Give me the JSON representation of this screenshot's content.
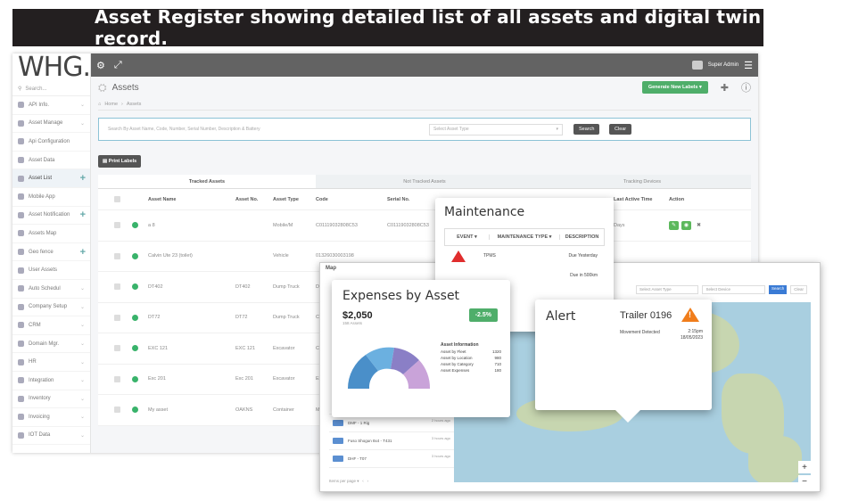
{
  "banner": {
    "text": "Asset Register showing detailed list of all  assets and digital twin record."
  },
  "sidebar": {
    "logo": "WHG.",
    "search": "Search...",
    "items": [
      {
        "label": "API Info.",
        "suffix": "chev"
      },
      {
        "label": "Asset Manage",
        "suffix": "chev"
      },
      {
        "label": "Api Configuration",
        "suffix": ""
      },
      {
        "label": "Asset Data",
        "suffix": ""
      },
      {
        "label": "Asset List",
        "suffix": "plus",
        "active": true
      },
      {
        "label": "Mobile App",
        "suffix": ""
      },
      {
        "label": "Asset Notification",
        "suffix": "plus"
      },
      {
        "label": "Assets Map",
        "suffix": ""
      },
      {
        "label": "Geo fence",
        "suffix": "plus"
      },
      {
        "label": "User Assets",
        "suffix": ""
      },
      {
        "label": "Auto Schedul",
        "suffix": "chev"
      },
      {
        "label": "Company Setup",
        "suffix": "chev"
      },
      {
        "label": "CRM",
        "suffix": "chev"
      },
      {
        "label": "Domain Mgr.",
        "suffix": "chev"
      },
      {
        "label": "HR",
        "suffix": "chev"
      },
      {
        "label": "Integration",
        "suffix": "chev"
      },
      {
        "label": "Inventory",
        "suffix": "chev"
      },
      {
        "label": "Invoicing",
        "suffix": "chev"
      },
      {
        "label": "IOT Data",
        "suffix": "chev"
      }
    ]
  },
  "topbar": {
    "user": "Super Admin"
  },
  "page": {
    "title": "Assets",
    "generate_label": "Generate New Labels",
    "breadcrumb_home": "Home",
    "breadcrumb_current": "Assets",
    "search_placeholder": "Search By Asset Name, Code, Number, Serial Number, Description & Battery",
    "asset_type_placeholder": "Select Asset Type",
    "search_btn": "Search",
    "clear_btn": "Clear",
    "print_labels": "Print Labels",
    "tabs": [
      "Tracked Assets",
      "Not Tracked Assets",
      "Tracking Devices"
    ]
  },
  "table": {
    "headers": {
      "name": "Asset Name",
      "no": "Asset No.",
      "type": "Asset Type",
      "code": "Code",
      "serial": "Serial No.",
      "active": "Last Active Time",
      "action": "Action"
    },
    "rows": [
      {
        "name": "a 8",
        "no": "",
        "type": "Mobile/M",
        "code": "C01119032808C53",
        "serial": "C01119032808C53",
        "active": "Days"
      },
      {
        "name": "Calvin Ute 23 (toilet)",
        "no": "",
        "type": "Vehicle",
        "code": "01326030003198",
        "serial": "",
        "active": ""
      },
      {
        "name": "DT402",
        "no": "DT402",
        "type": "Dump Truck",
        "code": "DT402",
        "serial": "",
        "active": ""
      },
      {
        "name": "DT72",
        "no": "DT72",
        "type": "Dump Truck",
        "code": "C011",
        "serial": "",
        "active": ""
      },
      {
        "name": "EXC 121",
        "no": "EXC 121",
        "type": "Excavator",
        "code": "C011",
        "serial": "",
        "active": ""
      },
      {
        "name": "Exc 201",
        "no": "Exc 201",
        "type": "Excavator",
        "code": "Exc 201",
        "serial": "",
        "active": ""
      },
      {
        "name": "My asset",
        "no": "OAKNS",
        "type": "Container",
        "code": "Myas",
        "serial": "",
        "active": ""
      }
    ]
  },
  "maintenance": {
    "title": "Maintenance",
    "col_event": "EVENT",
    "col_type": "MAINTENANCE TYPE",
    "col_desc": "DESCRIPTION",
    "rows": [
      {
        "type": "TPMS",
        "due": "Due Yesterday"
      },
      {
        "type": "",
        "due": "Due in 500km"
      }
    ]
  },
  "expenses": {
    "title": "Expenses by Asset",
    "amount": "$2,050",
    "assets": "158 Assets",
    "change": "-2.5%",
    "info_title": "Asset Information",
    "info_rows": [
      {
        "k": "Asset by Fleet",
        "v": "1320"
      },
      {
        "k": "Asset by Location",
        "v": "980"
      },
      {
        "k": "Asset by Category",
        "v": "710"
      },
      {
        "k": "Asset Expenses",
        "v": "180"
      }
    ]
  },
  "alert": {
    "title": "Alert",
    "asset": "Trailer 0196",
    "message": "Movement Detected",
    "time": "2:15pm",
    "date": "18/05/2023"
  },
  "map": {
    "header": "Map",
    "filter_type": "Select Asset Type",
    "filter_device": "Select Device",
    "search": "Search",
    "clear": "Clear",
    "list": [
      {
        "name": "ASP - T/Mil",
        "time": "2 hours ago"
      },
      {
        "name": "DMF - 1 Rig",
        "time": "2 hours ago"
      },
      {
        "name": "Fuso Shogun 8x4 - T431",
        "time": "3 hours ago"
      },
      {
        "name": "DHF - T07",
        "time": "3 hours ago"
      }
    ],
    "footer": "Items per page"
  }
}
